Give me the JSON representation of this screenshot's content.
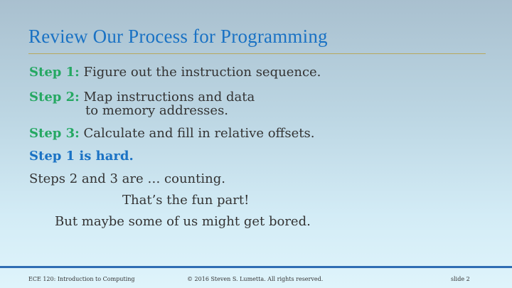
{
  "slide": {
    "title": "Review Our Process for Programming",
    "step1_label": "Step 1:",
    "step1_text": "Figure out the instruction sequence.",
    "step2_label": "Step 2:",
    "step2_text_line1": "Map instructions and data",
    "step2_text_line2": "to memory addresses.",
    "step3_label": "Step 3:",
    "step3_text": "Calculate and fill in relative offsets.",
    "hard_text": "Step 1 is hard.",
    "counting_text": "Steps 2 and 3 are … counting.",
    "fun_text": "That’s the fun part!",
    "bored_text": "But maybe some of us might get bored."
  },
  "footer": {
    "course": "ECE 120: Introduction to Computing",
    "copyright": "© 2016 Steven S. Lumetta.  All rights reserved.",
    "slide_number": "slide 2"
  },
  "colors": {
    "title": "#1a72c4",
    "step_label": "#25a862",
    "body_text": "#333333",
    "rule": "#b7a95c",
    "bottom_bar": "#2f6db3"
  }
}
